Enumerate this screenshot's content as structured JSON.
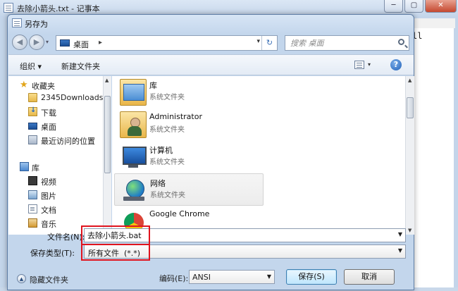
{
  "notepad": {
    "title": "去除小箭头.txt - 记事本",
    "controls": {
      "minimize": "─",
      "maximize": "▢",
      "close": "✕"
    },
    "editor_text": "ll"
  },
  "dialog": {
    "title": "另存为",
    "address": {
      "location": "桌面",
      "separator": "▸",
      "dropdown": "▾",
      "refresh": "↻"
    },
    "search": {
      "placeholder": "搜索 桌面"
    },
    "nav_buttons": {
      "back": "◀",
      "forward": "▶",
      "dropdown": "▾"
    },
    "toolbar": {
      "organize": "组织 ▾",
      "new_folder": "新建文件夹",
      "view_dropdown": "▾",
      "help": "?"
    },
    "nav_pane": {
      "items": [
        {
          "label": "收藏夹",
          "icon": "star-icon"
        },
        {
          "label": "2345Downloads",
          "icon": "folder-icon"
        },
        {
          "label": "下载",
          "icon": "downloads-folder-icon"
        },
        {
          "label": "桌面",
          "icon": "desktop-icon"
        },
        {
          "label": "最近访问的位置",
          "icon": "recent-places-icon"
        },
        {
          "label": "库",
          "icon": "libraries-icon"
        },
        {
          "label": "视频",
          "icon": "videos-icon"
        },
        {
          "label": "图片",
          "icon": "pictures-icon"
        },
        {
          "label": "文档",
          "icon": "documents-icon"
        },
        {
          "label": "音乐",
          "icon": "music-icon"
        }
      ]
    },
    "files": [
      {
        "name": "库",
        "type": "系统文件夹",
        "icon": "library-folder-icon"
      },
      {
        "name": "Administrator",
        "type": "系统文件夹",
        "icon": "user-folder-icon"
      },
      {
        "name": "计算机",
        "type": "系统文件夹",
        "icon": "computer-icon"
      },
      {
        "name": "网络",
        "type": "系统文件夹",
        "icon": "network-icon"
      },
      {
        "name": "Google Chrome",
        "type": "",
        "icon": "chrome-icon"
      }
    ],
    "form": {
      "filename_label": "文件名(N):",
      "filename_value": "去除小箭头.bat",
      "filetype_label": "保存类型(T):",
      "filetype_value": "所有文件  (*.*)"
    },
    "bottom": {
      "hide_folders": "隐藏文件夹",
      "hide_icon": "▲",
      "encoding_label": "编码(E):",
      "encoding_value": "ANSI",
      "save_button": "保存(S)",
      "cancel_button": "取消"
    },
    "highlight_color": "#e0141e"
  }
}
